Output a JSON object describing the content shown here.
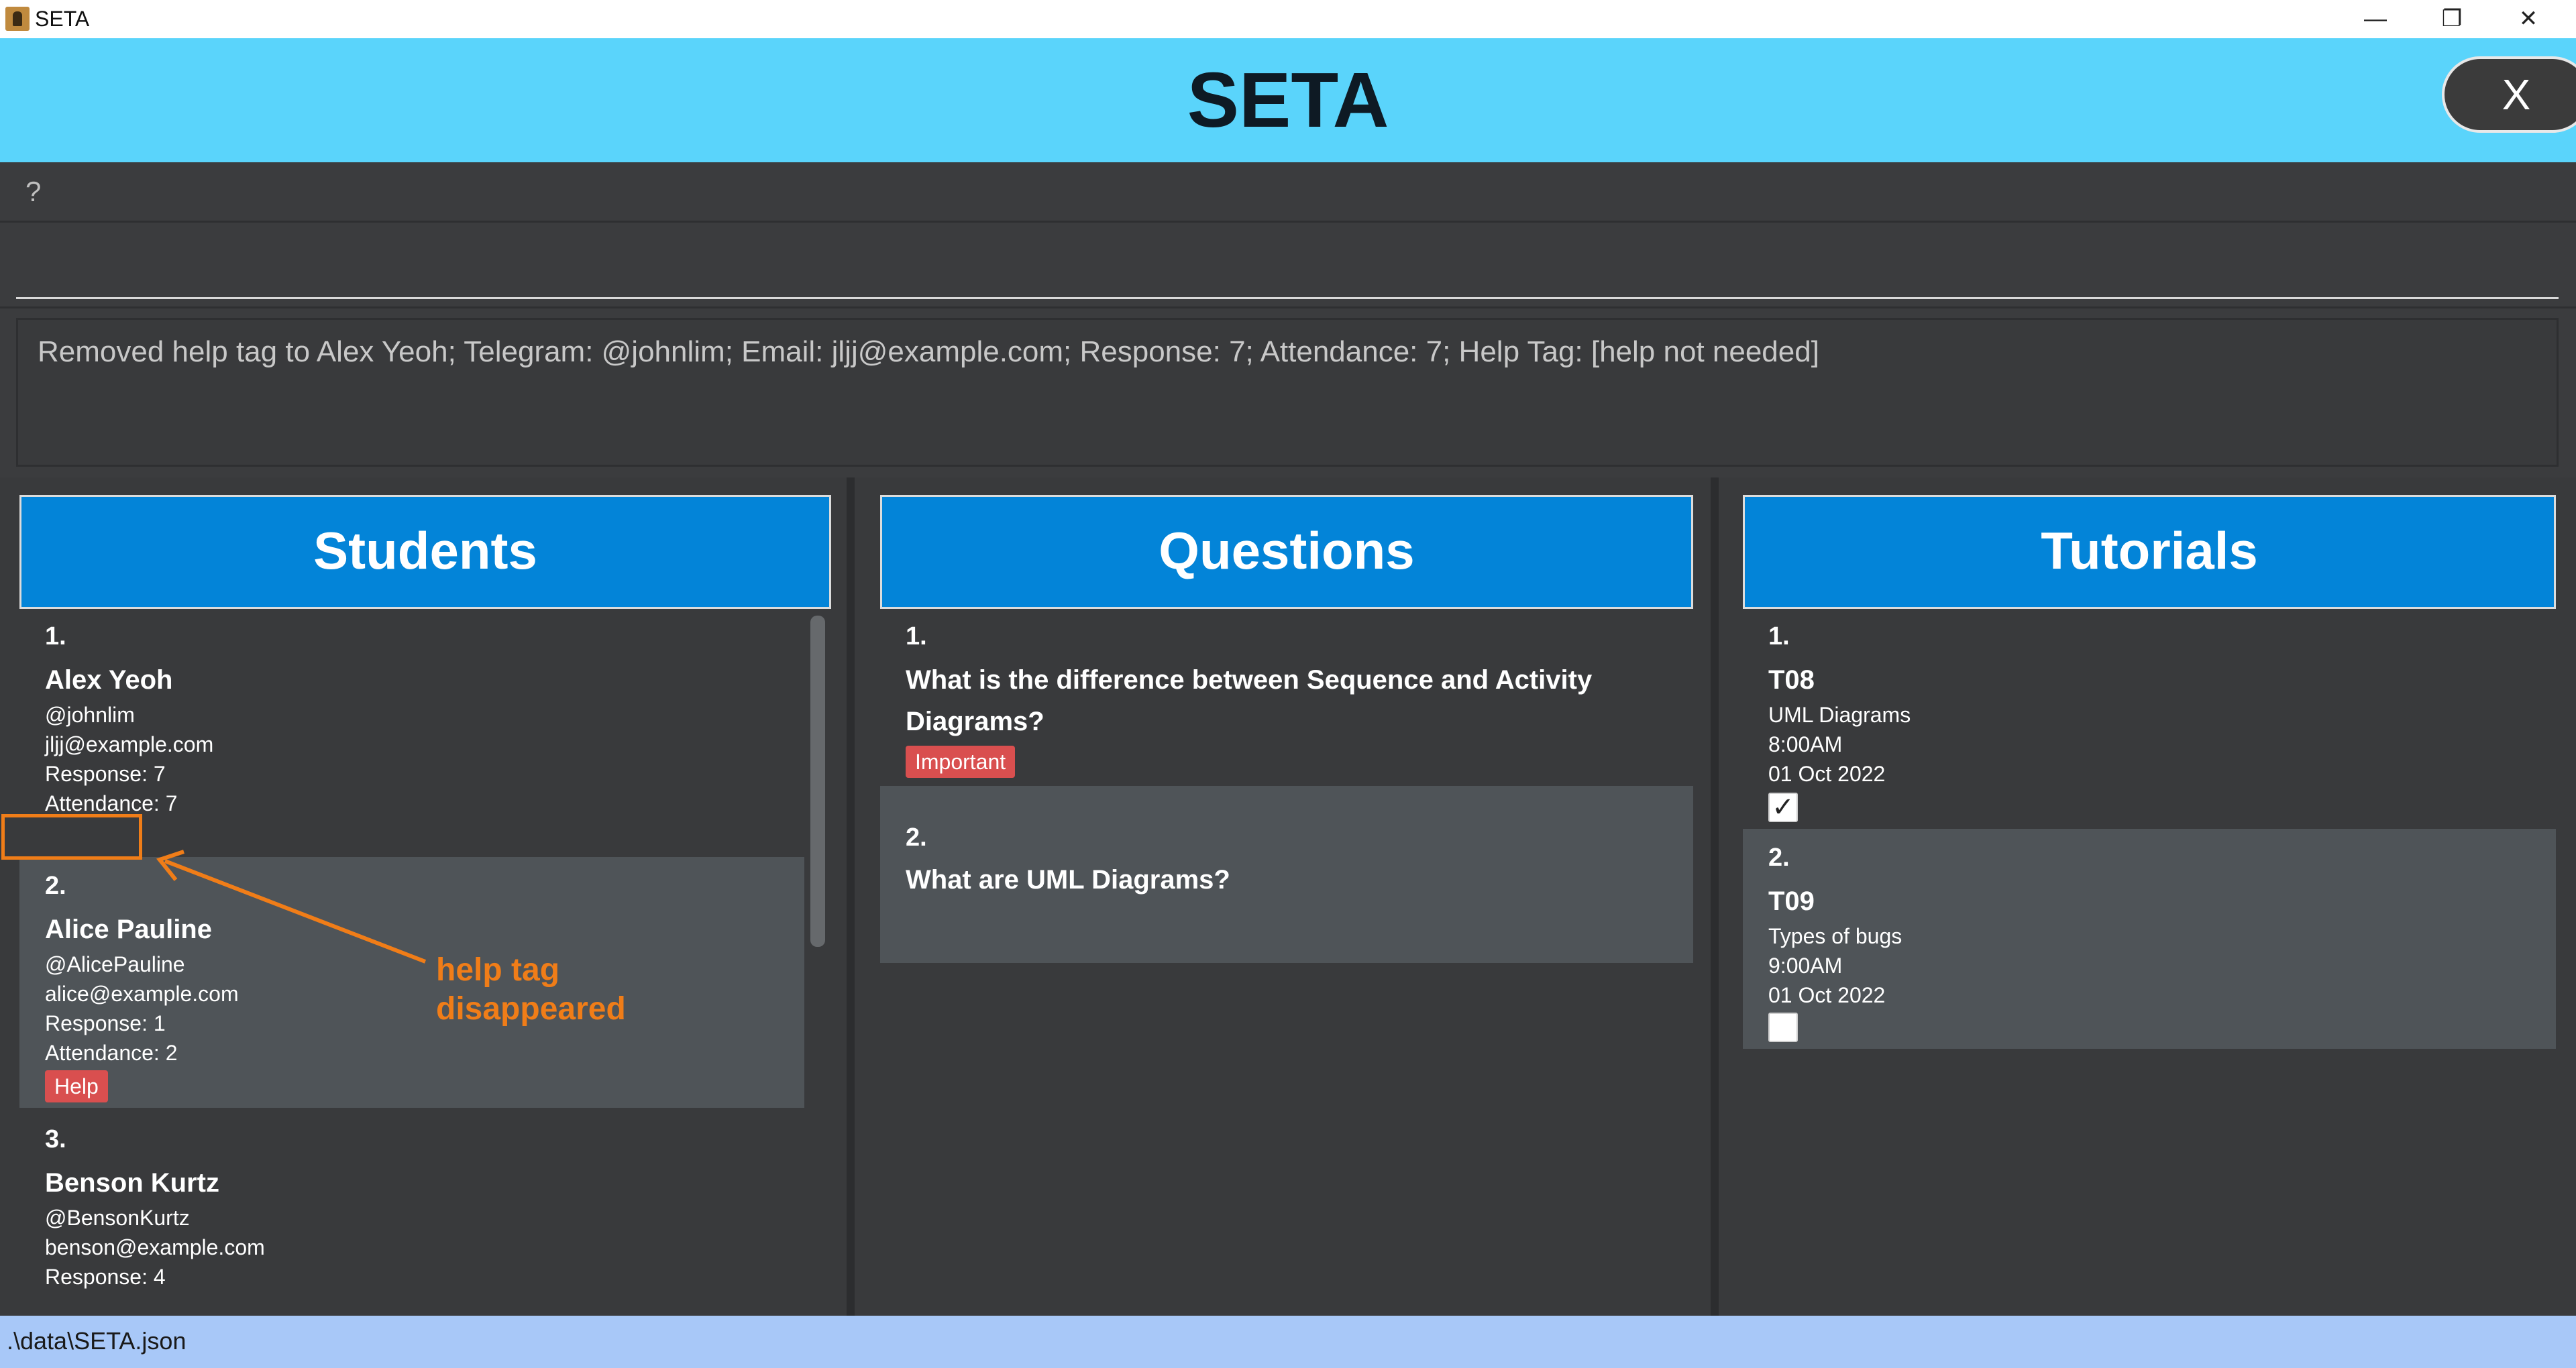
{
  "window": {
    "title": "SETA",
    "min_icon": "—",
    "max_icon": "❐",
    "close_icon": "✕"
  },
  "header": {
    "title": "SETA",
    "close_label": "X"
  },
  "menu": {
    "help_label": "?"
  },
  "command": {
    "value": "",
    "placeholder": ""
  },
  "result": {
    "text": "Removed help tag to Alex Yeoh; Telegram: @johnlim; Email: jljj@example.com; Response: 7; Attendance: 7; Help Tag: [help not needed]"
  },
  "students": {
    "title": "Students",
    "items": [
      {
        "index": "1.",
        "name": "Alex Yeoh",
        "telegram": "@johnlim",
        "email": "jljj@example.com",
        "response": "Response: 7",
        "attendance": "Attendance: 7"
      },
      {
        "index": "2.",
        "name": "Alice Pauline",
        "telegram": "@AlicePauline",
        "email": "alice@example.com",
        "response": "Response: 1",
        "attendance": "Attendance: 2",
        "tag": "Help"
      },
      {
        "index": "3.",
        "name": "Benson Kurtz",
        "telegram": "@BensonKurtz",
        "email": "benson@example.com",
        "response": "Response: 4"
      }
    ]
  },
  "questions": {
    "title": "Questions",
    "items": [
      {
        "index": "1.",
        "text_line1": "What is the difference between Sequence and Activity",
        "text_line2": "Diagrams?",
        "tag": "Important"
      },
      {
        "index": "2.",
        "text_line1": "What are UML Diagrams?"
      }
    ]
  },
  "tutorials": {
    "title": "Tutorials",
    "items": [
      {
        "index": "1.",
        "group": "T08",
        "content": "UML Diagrams",
        "time": "8:00AM",
        "date": "01 Oct 2022",
        "done": true
      },
      {
        "index": "2.",
        "group": "T09",
        "content": "Types of bugs",
        "time": "9:00AM",
        "date": "01 Oct 2022",
        "done": false
      }
    ]
  },
  "annotation": {
    "text_line1": "help tag",
    "text_line2": "disappeared",
    "color": "#f07d18"
  },
  "status": {
    "path": ".\\data\\SETA.json"
  },
  "colors": {
    "header_bg": "#5ad4fb",
    "panel_header": "#0384d8",
    "tag_red": "#d94f4f",
    "status_bg": "#a8c8f8"
  }
}
